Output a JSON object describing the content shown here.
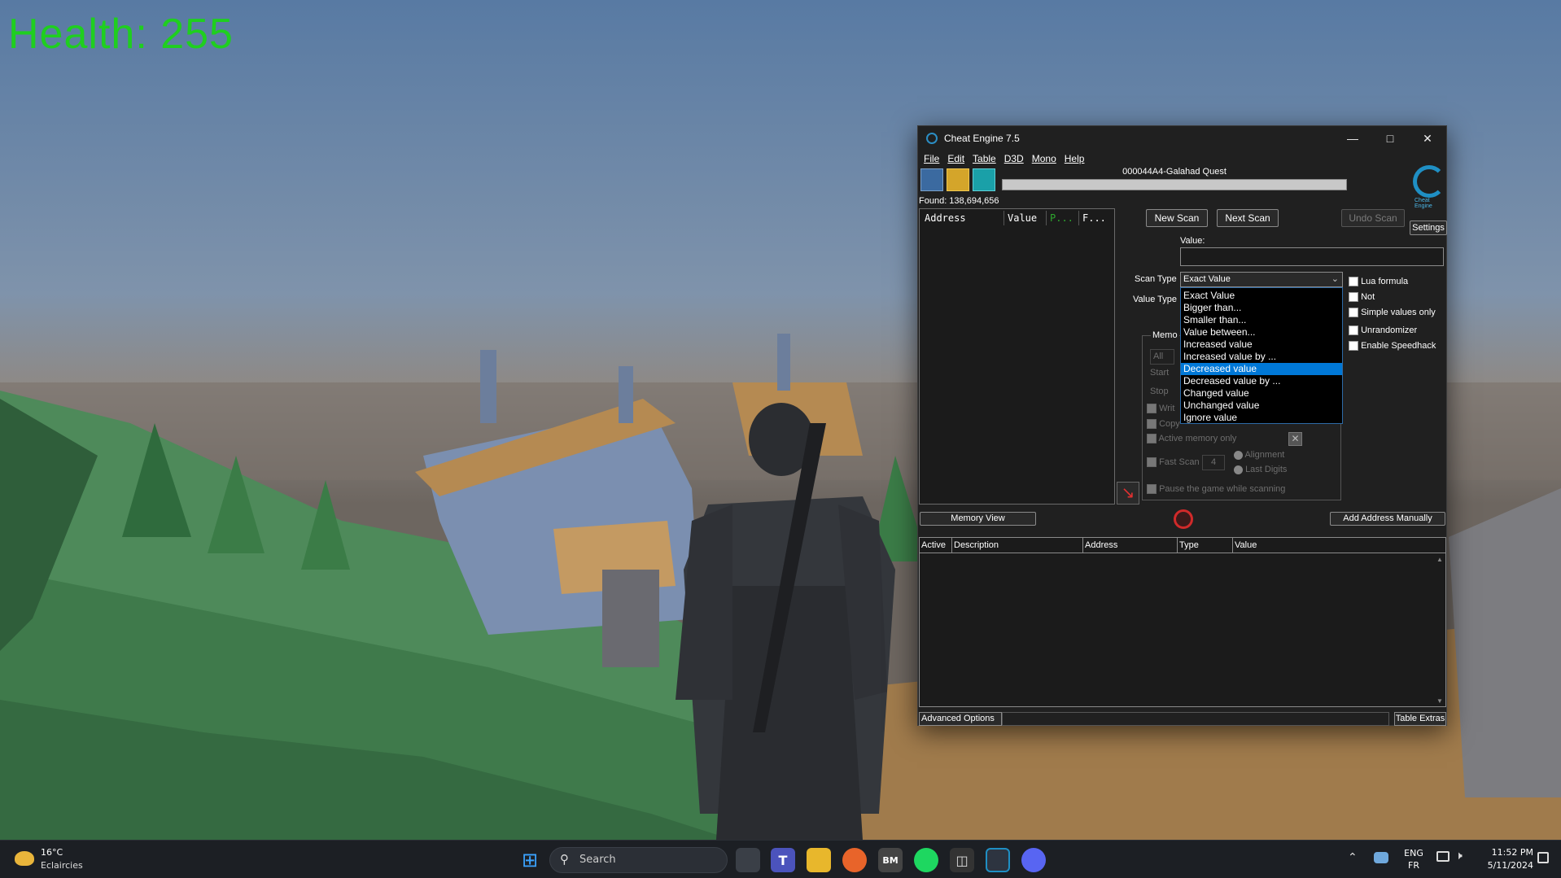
{
  "game": {
    "health_text": "Health: 255"
  },
  "ce": {
    "title": "Cheat Engine 7.5",
    "menu": [
      "File",
      "Edit",
      "Table",
      "D3D",
      "Mono",
      "Help"
    ],
    "process_name": "000044A4-Galahad Quest",
    "found_label": "Found: 138,694,656",
    "results_columns": [
      "Address",
      "Value",
      "P...",
      "F..."
    ],
    "buttons": {
      "new_scan": "New Scan",
      "next_scan": "Next Scan",
      "undo_scan": "Undo Scan",
      "settings": "Settings",
      "memory_view": "Memory View",
      "add_address": "Add Address Manually",
      "advanced_options": "Advanced Options",
      "table_extras": "Table Extras"
    },
    "value_label": "Value:",
    "value_input": "",
    "scan_type_label": "Scan Type",
    "scan_type_selected": "Exact Value",
    "value_type_label": "Value Type",
    "scan_type_options": [
      "Exact Value",
      "Bigger than...",
      "Smaller than...",
      "Value between...",
      "Increased value",
      "Increased value by ...",
      "Decreased value",
      "Decreased value by ...",
      "Changed value",
      "Unchanged value",
      "Ignore value"
    ],
    "highlighted_option_index": 6,
    "options": {
      "lua_formula": "Lua formula",
      "not": "Not",
      "simple_values_only": "Simple values only",
      "unrandomizer": "Unrandomizer",
      "enable_speedhack": "Enable Speedhack"
    },
    "memory": {
      "group_label": "Memo",
      "all_label": "All",
      "start_label": "Start",
      "stop_label": "Stop",
      "writable_label": "Writ",
      "copy_on_write_label": "Copy",
      "active_memory_only": "Active memory only",
      "fast_scan": "Fast Scan",
      "fast_scan_value": "4",
      "alignment": "Alignment",
      "last_digits": "Last Digits",
      "pause_game": "Pause the game while scanning"
    },
    "address_columns": [
      "Active",
      "Description",
      "Address",
      "Type",
      "Value"
    ],
    "logo_caption": "Cheat Engine"
  },
  "taskbar": {
    "weather_temp": "16°C",
    "weather_desc": "Eclaircies",
    "search_placeholder": "Search",
    "lang_top": "ENG",
    "lang_bottom": "FR",
    "time": "11:52 PM",
    "date": "5/11/2024"
  },
  "colors": {
    "health_green": "#1fcf1f",
    "ce_bg": "#202020",
    "selection_blue": "#0078d7",
    "taskbar_bg": "#1c1f24"
  }
}
